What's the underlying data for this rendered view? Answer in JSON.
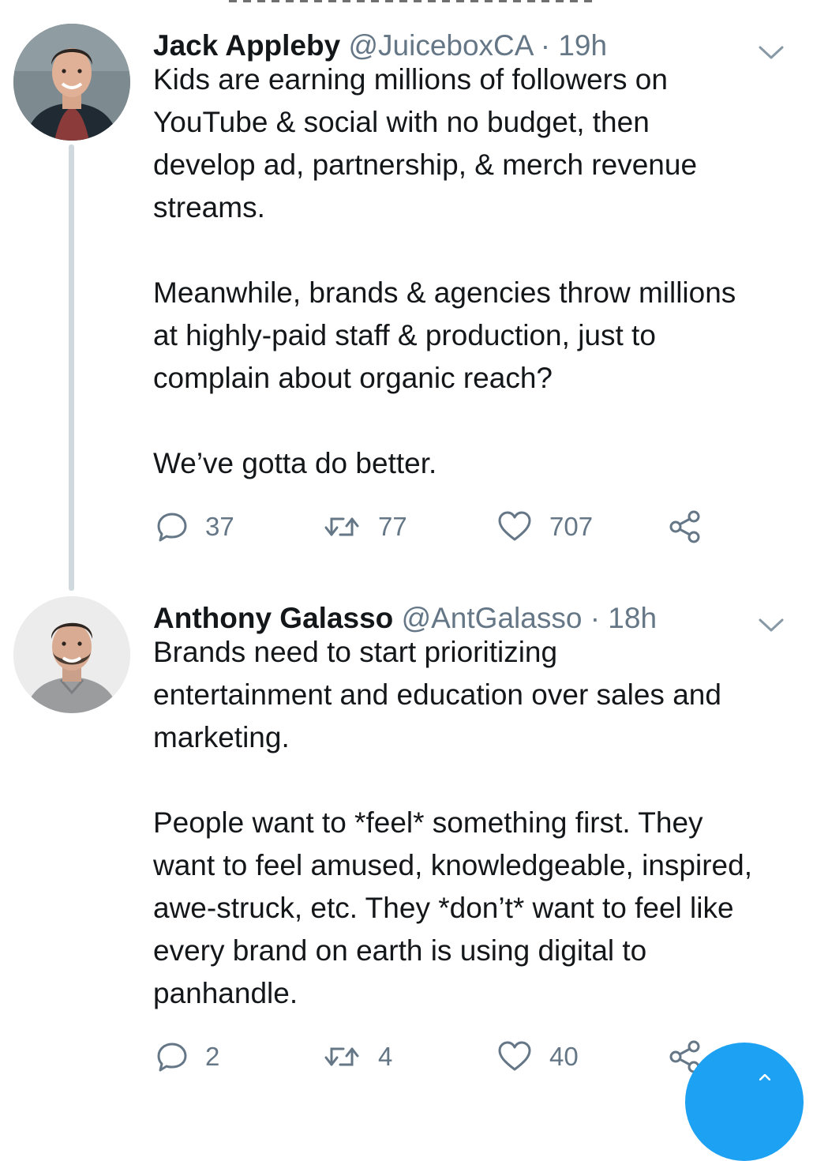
{
  "tweets": [
    {
      "name": "Jack Appleby",
      "handle": "@JuiceboxCA",
      "separator": "·",
      "time": "19h",
      "paragraphs": [
        "Kids are earning millions of followers on\nYouTube & social with no budget, then\ndevelop ad, partnership, & merch revenue\nstreams.",
        "Meanwhile, brands & agencies throw millions\nat highly-paid staff & production, just to\ncomplain about organic reach?",
        "We’ve gotta do better."
      ],
      "replies": "37",
      "retweets": "77",
      "likes": "707"
    },
    {
      "name": "Anthony Galasso",
      "handle": "@AntGalasso",
      "separator": "·",
      "time": "18h",
      "paragraphs": [
        "Brands need to start prioritizing\nentertainment and education over sales and\nmarketing.",
        "People want to *feel* something first. They\nwant to feel amused, knowledgeable, inspired,\nawe-struck, etc. They *don’t* want to feel like\nevery brand on earth is using digital to\npanhandle."
      ],
      "replies": "2",
      "retweets": "4",
      "likes": "40"
    }
  ],
  "colors": {
    "text": "#14171a",
    "secondary": "#657786",
    "thread_line": "#cfd9de",
    "fab": "#1da1f2"
  },
  "icons": [
    "reply-icon",
    "retweet-icon",
    "like-icon",
    "share-icon",
    "chevron-down-icon",
    "compose-icon"
  ]
}
